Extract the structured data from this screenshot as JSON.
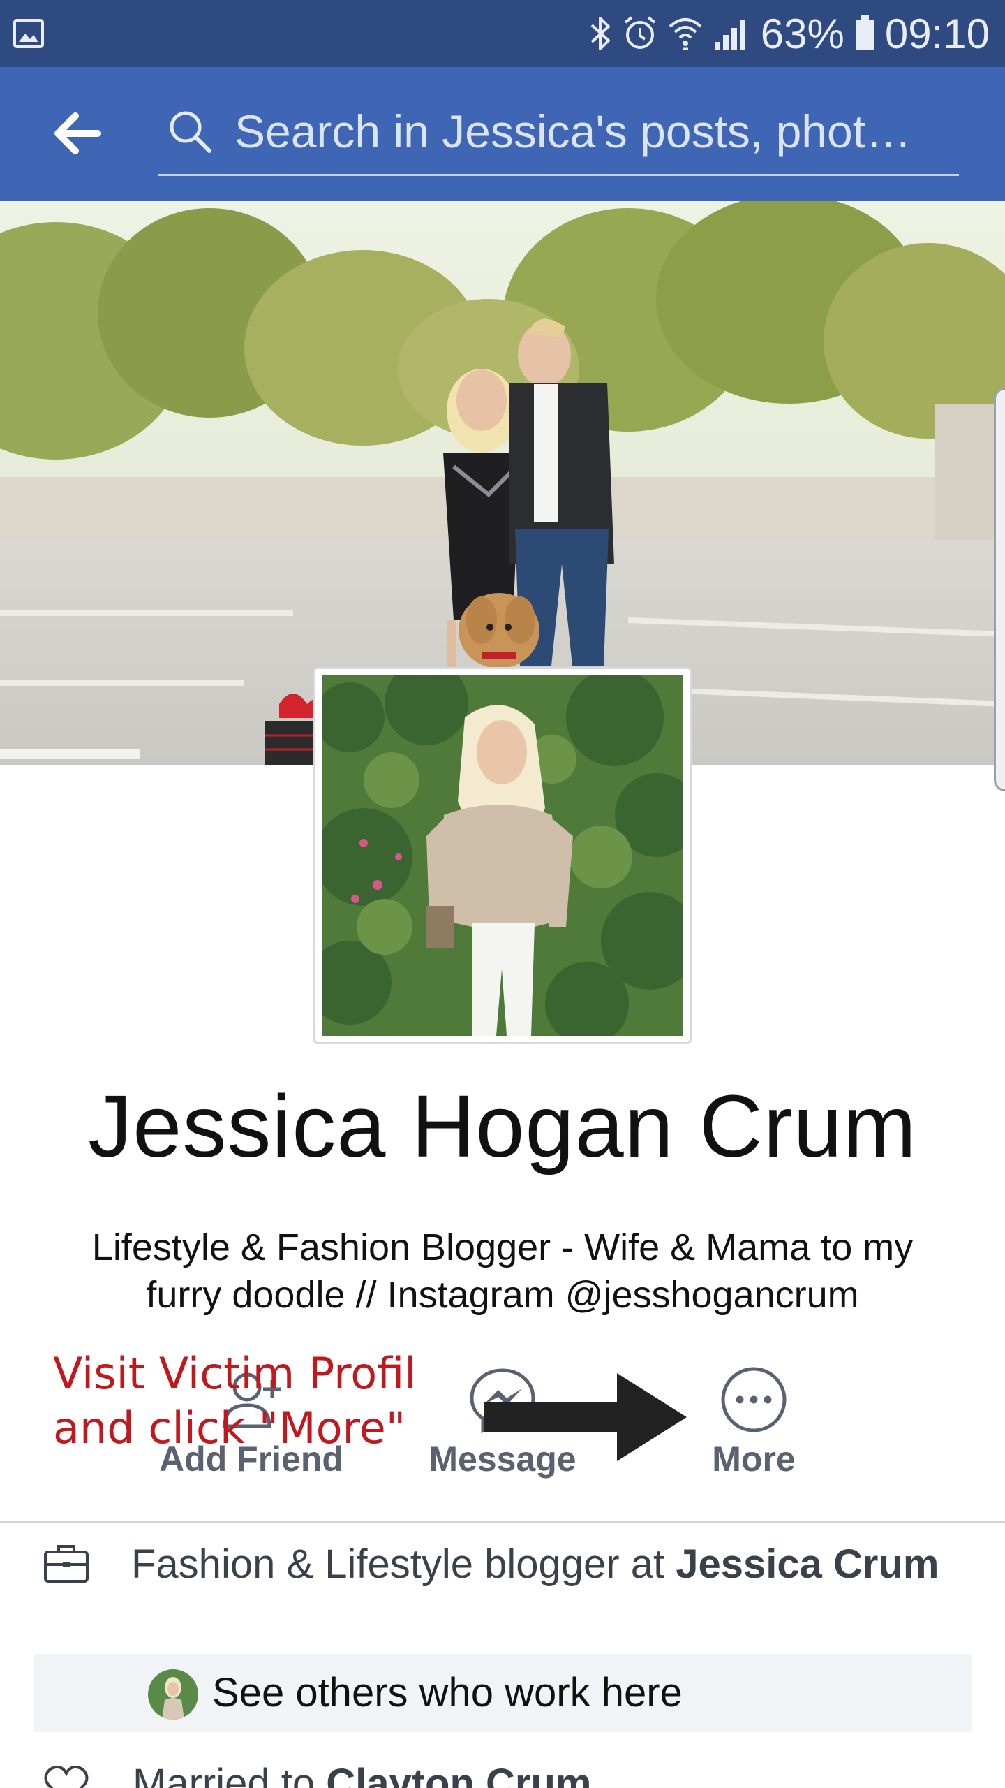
{
  "status_bar": {
    "battery_percent": "63%",
    "time": "09:10",
    "icons": [
      "gallery-icon",
      "bluetooth-icon",
      "alarm-icon",
      "wifi-icon",
      "signal-icon",
      "battery-icon"
    ]
  },
  "app_bar": {
    "back_icon": "back-arrow-icon",
    "search_placeholder": "Search in Jessica's posts, phot…",
    "search_icon": "search-icon"
  },
  "profile": {
    "name": "Jessica Hogan Crum",
    "bio": "Lifestyle & Fashion Blogger - Wife & Mama to my furry doodle // Instagram @jesshogancrum"
  },
  "actions": [
    {
      "label": "Add Friend",
      "icon": "add-friend-icon"
    },
    {
      "label": "Message",
      "icon": "messenger-icon"
    },
    {
      "label": "More",
      "icon": "more-icon"
    }
  ],
  "annotation": {
    "text": "Visit Victim Profil\nand click \"More\"",
    "color": "#c0181c"
  },
  "about": {
    "work_prefix": "Fashion & Lifestyle blogger at ",
    "work_employer": "Jessica Crum",
    "see_others": "See others who work here",
    "married_prefix": "Married to ",
    "married_name": "Clayton Crum"
  },
  "colors": {
    "status_bar": "#2f4a80",
    "app_bar": "#3f66b4",
    "action_gray": "#5a6270"
  }
}
